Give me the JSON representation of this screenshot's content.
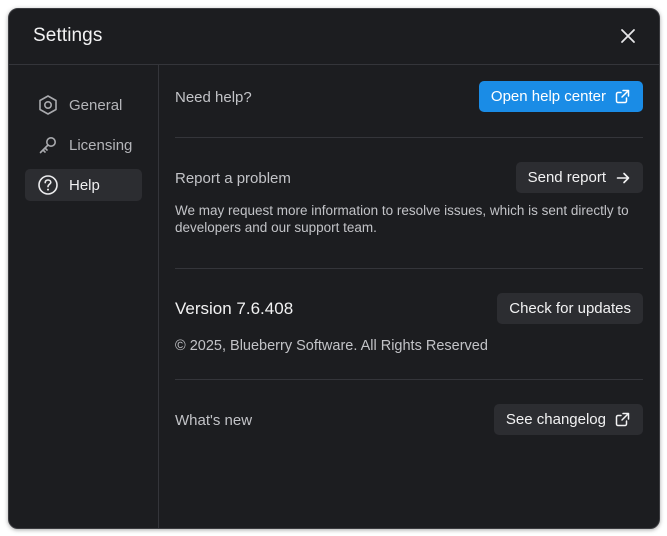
{
  "window": {
    "title": "Settings"
  },
  "sidebar": {
    "items": [
      {
        "label": "General",
        "icon": "hexagon-gear-icon",
        "active": false
      },
      {
        "label": "Licensing",
        "icon": "key-icon",
        "active": false
      },
      {
        "label": "Help",
        "icon": "help-circle-icon",
        "active": true
      }
    ]
  },
  "help": {
    "need_help_label": "Need help?",
    "open_help_center_label": "Open help center",
    "report_label": "Report a problem",
    "send_report_label": "Send report",
    "report_description": "We may request more information to resolve issues, which is sent directly to developers and our support team.",
    "version_label": "Version 7.6.408",
    "check_updates_label": "Check for updates",
    "copyright": "© 2025, Blueberry Software. All Rights Reserved",
    "whats_new_label": "What's new",
    "changelog_label": "See changelog"
  },
  "colors": {
    "background": "#1c1d20",
    "accent": "#1a8ce6",
    "button": "#2c2d31",
    "divider": "#34353a"
  }
}
